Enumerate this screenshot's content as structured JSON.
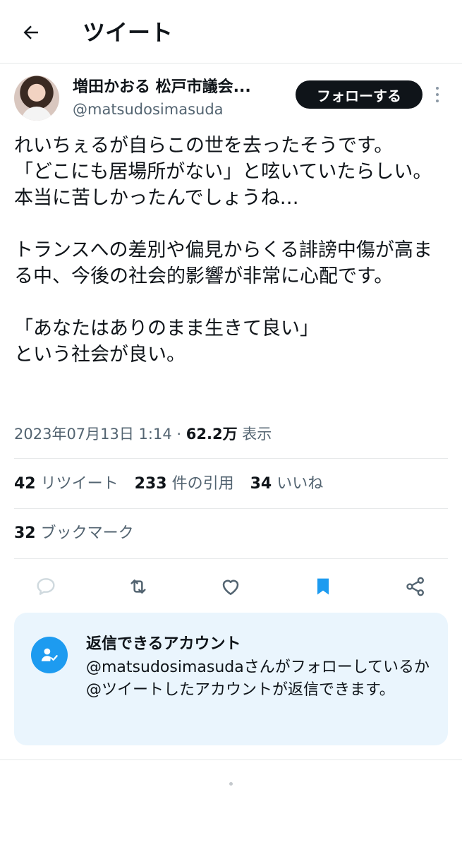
{
  "header": {
    "title": "ツイート"
  },
  "author": {
    "display_name": "増田かおる 松戸市議会...",
    "handle": "@matsudosimasuda",
    "follow_label": "フォローする"
  },
  "tweet": {
    "text": "れいちぇるが自らこの世を去ったそうです。\n「どこにも居場所がない」と呟いていたらしい。本当に苦しかったんでしょうね…\n\nトランスへの差別や偏見からくる誹謗中傷が高まる中、今後の社会的影響が非常に心配です。\n\n「あなたはありのまま生きて良い」\nという社会が良い。",
    "timestamp": "2023年07月13日 1:14",
    "separator": " · ",
    "views_count": "62.2万",
    "views_label": " 表示"
  },
  "stats": {
    "retweets_count": "42",
    "retweets_label": "リツイート",
    "quotes_count": "233",
    "quotes_label": "件の引用",
    "likes_count": "34",
    "likes_label": "いいね",
    "bookmarks_count": "32",
    "bookmarks_label": "ブックマーク"
  },
  "actions": {
    "icons": [
      "reply-icon",
      "retweet-icon",
      "like-icon",
      "bookmark-icon",
      "share-icon"
    ],
    "bookmark_active_color": "#1d9bf0",
    "inactive_color": "#536471"
  },
  "reply_restriction": {
    "title": "返信できるアカウント",
    "description": "@matsudosimasudaさんがフォローしているか@ツイートしたアカウントが返信できます。"
  },
  "colors": {
    "accent": "#1d9bf0",
    "notice_bg": "#eaf5fd",
    "text_primary": "#0f1419",
    "text_secondary": "#536471"
  }
}
